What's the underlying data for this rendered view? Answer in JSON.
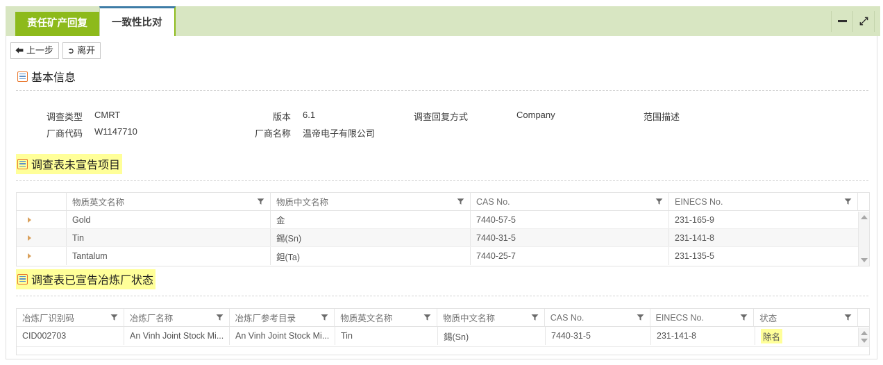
{
  "window": {
    "minimize_label": "minimize",
    "maximize_label": "maximize"
  },
  "tabs": [
    {
      "label": "责任矿产回复",
      "active": false
    },
    {
      "label": "一致性比对",
      "active": true
    }
  ],
  "toolbar": {
    "back_label": "上一步",
    "back_icon": "arrow-left",
    "exit_label": "离开",
    "exit_icon": "exit"
  },
  "sections": {
    "basic_info": {
      "title": "基本信息",
      "highlighted": false
    },
    "undeclared_items": {
      "title": "调查表未宣告项目",
      "highlighted": true
    },
    "declared_smelter_status": {
      "title": "调查表已宣告冶炼厂状态",
      "highlighted": true
    }
  },
  "basic_info_fields": [
    {
      "label": "调查类型",
      "value": "CMRT"
    },
    {
      "label": "版本",
      "value": "6.1"
    },
    {
      "label": "调查回复方式",
      "value": "Company"
    },
    {
      "label": "范围描述",
      "value": ""
    },
    {
      "label": "厂商代码",
      "value": "W1147710"
    },
    {
      "label": "厂商名称",
      "value": "温帝电子有限公司"
    }
  ],
  "undeclared_grid": {
    "columns": [
      {
        "label": "",
        "filter": false
      },
      {
        "label": "物质英文名称",
        "filter": true
      },
      {
        "label": "物质中文名称",
        "filter": true
      },
      {
        "label": "CAS No.",
        "filter": true
      },
      {
        "label": "EINECS No.",
        "filter": true
      }
    ],
    "rows": [
      {
        "substance_en": "Gold",
        "substance_cn": "金",
        "cas": "7440-57-5",
        "einecs": "231-165-9"
      },
      {
        "substance_en": "Tin",
        "substance_cn": "錫(Sn)",
        "cas": "7440-31-5",
        "einecs": "231-141-8"
      },
      {
        "substance_en": "Tantalum",
        "substance_cn": "鉭(Ta)",
        "cas": "7440-25-7",
        "einecs": "231-135-5"
      }
    ]
  },
  "smelter_grid": {
    "columns": [
      {
        "label": "冶炼厂识别码",
        "filter": true
      },
      {
        "label": "冶炼厂名称",
        "filter": true
      },
      {
        "label": "冶炼厂参考目录",
        "filter": true
      },
      {
        "label": "物质英文名称",
        "filter": true
      },
      {
        "label": "物质中文名称",
        "filter": true
      },
      {
        "label": "CAS No.",
        "filter": true
      },
      {
        "label": "EINECS No.",
        "filter": true
      },
      {
        "label": "状态",
        "filter": true
      }
    ],
    "rows": [
      {
        "smelter_id": "CID002703",
        "smelter_name": "An Vinh Joint Stock Mi...",
        "smelter_ref": "An Vinh Joint Stock Mi...",
        "substance_en": "Tin",
        "substance_cn": "錫(Sn)",
        "cas": "7440-31-5",
        "einecs": "231-141-8",
        "status": "除名"
      }
    ]
  },
  "colors": {
    "titlebar": "#d8e6c2",
    "tab_inactive": "#8dba1b",
    "tab_active_border": "#3d7ca6",
    "highlight": "#ffff99",
    "icon_orange": "#e8762c"
  }
}
